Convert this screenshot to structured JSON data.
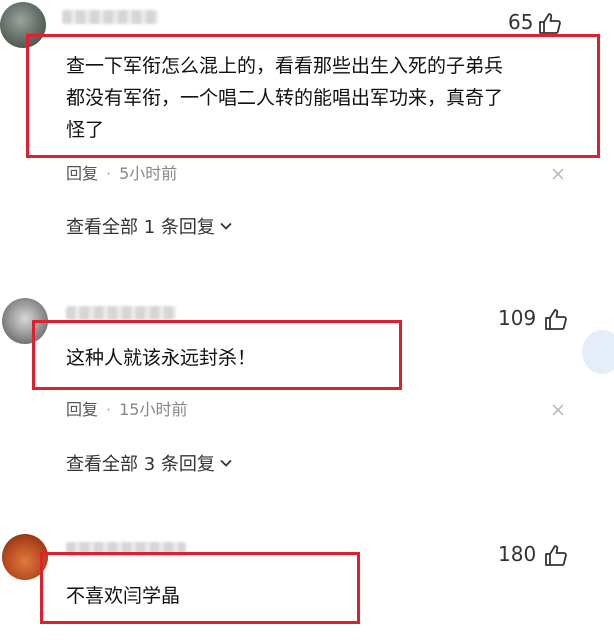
{
  "comments": [
    {
      "likes": "65",
      "text_line1": "查一下军衔怎么混上的，看看那些出生入死的子弟兵",
      "text_line2": "都没有军衔，一个唱二人转的能唱出军功来，真奇了",
      "text_line3": "怪了",
      "reply_label": "回复",
      "time": "5小时前",
      "view_replies": "查看全部 1 条回复"
    },
    {
      "likes": "109",
      "text": "这种人就该永远封杀！",
      "reply_label": "回复",
      "time": "15小时前",
      "view_replies": "查看全部 3 条回复"
    },
    {
      "likes": "180",
      "text": "不喜欢闫学晶"
    }
  ],
  "colors": {
    "highlight": "#e0202f",
    "thumb": "#333333"
  }
}
